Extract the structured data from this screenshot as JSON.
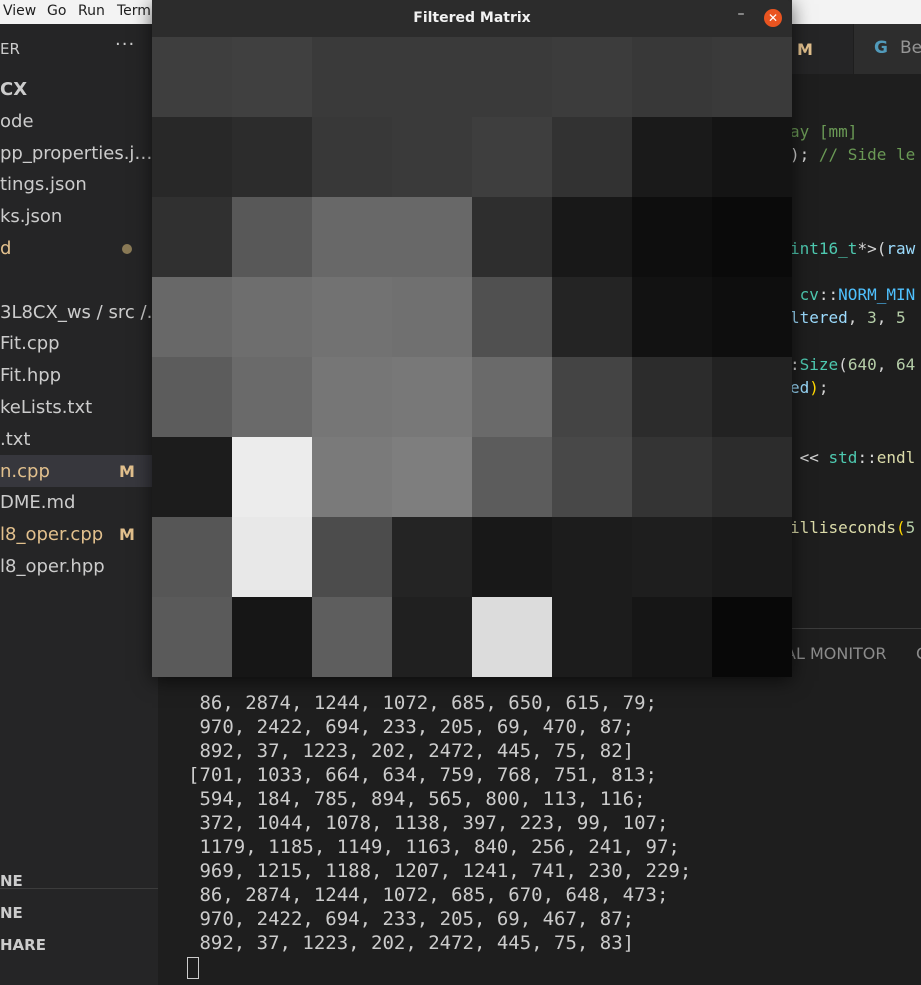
{
  "menu": {
    "items": [
      "View",
      "Go",
      "Run",
      "Term"
    ]
  },
  "sidebar": {
    "header": "ER",
    "more": "···",
    "items": [
      {
        "label": "CX",
        "badge": "",
        "dot": false,
        "bold": true,
        "modified": false
      },
      {
        "label": "ode",
        "badge": "",
        "dot": false,
        "bold": false,
        "modified": false
      },
      {
        "label": "pp_properties.j…",
        "badge": "",
        "dot": false,
        "bold": false,
        "modified": false
      },
      {
        "label": "tings.json",
        "badge": "",
        "dot": false,
        "bold": false,
        "modified": false
      },
      {
        "label": "ks.json",
        "badge": "",
        "dot": false,
        "bold": false,
        "modified": false
      },
      {
        "label": "d",
        "badge": "",
        "dot": true,
        "bold": false,
        "modified": true
      },
      {
        "label": "",
        "badge": "",
        "dot": false,
        "bold": false,
        "modified": false
      },
      {
        "label": "3L8CX_ws / src /…",
        "badge": "",
        "dot": false,
        "bold": false,
        "modified": false
      },
      {
        "label": "Fit.cpp",
        "badge": "",
        "dot": false,
        "bold": false,
        "modified": false
      },
      {
        "label": "Fit.hpp",
        "badge": "",
        "dot": false,
        "bold": false,
        "modified": false
      },
      {
        "label": "keLists.txt",
        "badge": "",
        "dot": false,
        "bold": false,
        "modified": false
      },
      {
        "label": ".txt",
        "badge": "",
        "dot": false,
        "bold": false,
        "modified": false
      },
      {
        "label": "n.cpp",
        "badge": "M",
        "dot": false,
        "bold": false,
        "modified": true,
        "selected": true
      },
      {
        "label": "DME.md",
        "badge": "",
        "dot": false,
        "bold": false,
        "modified": false
      },
      {
        "label": "l8_oper.cpp",
        "badge": "M",
        "dot": false,
        "bold": false,
        "modified": true
      },
      {
        "label": "l8_oper.hpp",
        "badge": "",
        "dot": false,
        "bold": false,
        "modified": false
      }
    ],
    "sections": [
      "NE",
      "NE",
      "HARE"
    ]
  },
  "tabs": {
    "badge": "M",
    "second": {
      "icon": "G",
      "label": "Be"
    }
  },
  "editor": {
    "lines": [
      [
        {
          "t": "ay [mm]",
          "c": "c-comment"
        }
      ],
      [
        {
          "t": ")",
          "c": "c-plain"
        },
        {
          "t": "; ",
          "c": "c-plain"
        },
        {
          "t": "// Side le",
          "c": "c-comment"
        }
      ],
      [],
      [],
      [],
      [
        {
          "t": "int16_t",
          "c": "c-type"
        },
        {
          "t": "*>(",
          "c": "c-plain"
        },
        {
          "t": "raw",
          "c": "c-var"
        }
      ],
      [],
      [
        {
          "t": " cv",
          "c": "c-type"
        },
        {
          "t": "::",
          "c": "c-plain"
        },
        {
          "t": "NORM_MIN",
          "c": "c-const"
        }
      ],
      [
        {
          "t": "ltered",
          "c": "c-var"
        },
        {
          "t": ", ",
          "c": "c-plain"
        },
        {
          "t": "3",
          "c": "c-num"
        },
        {
          "t": ", ",
          "c": "c-plain"
        },
        {
          "t": "5",
          "c": "c-num"
        }
      ],
      [],
      [
        {
          "t": ":",
          "c": "c-plain"
        },
        {
          "t": "Size",
          "c": "c-type"
        },
        {
          "t": "(",
          "c": "c-plain"
        },
        {
          "t": "640",
          "c": "c-num"
        },
        {
          "t": ", ",
          "c": "c-plain"
        },
        {
          "t": "64",
          "c": "c-num"
        }
      ],
      [
        {
          "t": "ed",
          "c": "c-var"
        },
        {
          "t": ")",
          "c": "c-brace"
        },
        {
          "t": ";",
          "c": "c-plain"
        }
      ],
      [],
      [],
      [
        {
          "t": " << ",
          "c": "c-plain"
        },
        {
          "t": "std",
          "c": "c-type"
        },
        {
          "t": "::",
          "c": "c-plain"
        },
        {
          "t": "endl",
          "c": "c-fn"
        }
      ],
      [],
      [],
      [
        {
          "t": "illiseconds",
          "c": "c-fn"
        },
        {
          "t": "(",
          "c": "c-brace"
        },
        {
          "t": "5",
          "c": "c-num"
        }
      ]
    ]
  },
  "panel": {
    "tabs": [
      "AL MONITOR",
      "C"
    ]
  },
  "terminal": {
    "lines": [
      " 86, 2874, 1244, 1072, 685, 650, 615, 79;",
      " 970, 2422, 694, 233, 205, 69, 470, 87;",
      " 892, 37, 1223, 202, 2472, 445, 75, 82]",
      "[701, 1033, 664, 634, 759, 768, 751, 813;",
      " 594, 184, 785, 894, 565, 800, 113, 116;",
      " 372, 1044, 1078, 1138, 397, 223, 99, 107;",
      " 1179, 1185, 1149, 1163, 840, 256, 241, 97;",
      " 969, 1215, 1188, 1207, 1241, 741, 230, 229;",
      " 86, 2874, 1244, 1072, 685, 670, 648, 473;",
      " 970, 2422, 694, 233, 205, 69, 467, 87;",
      " 892, 37, 1223, 202, 2472, 445, 75, 83]"
    ]
  },
  "window": {
    "title": "Filtered Matrix",
    "minimize": "–",
    "close": "✕",
    "matrix": {
      "rows": 8,
      "cols": 8,
      "gray": [
        [
          62,
          64,
          58,
          58,
          58,
          60,
          56,
          58
        ],
        [
          40,
          44,
          56,
          58,
          62,
          50,
          26,
          20
        ],
        [
          48,
          88,
          104,
          104,
          46,
          24,
          14,
          10
        ],
        [
          104,
          110,
          114,
          112,
          80,
          36,
          18,
          14
        ],
        [
          92,
          106,
          118,
          120,
          106,
          68,
          44,
          34
        ],
        [
          28,
          236,
          122,
          126,
          92,
          72,
          52,
          44
        ],
        [
          86,
          232,
          76,
          36,
          24,
          28,
          30,
          26
        ],
        [
          90,
          22,
          94,
          32,
          220,
          28,
          22,
          8
        ]
      ]
    }
  }
}
